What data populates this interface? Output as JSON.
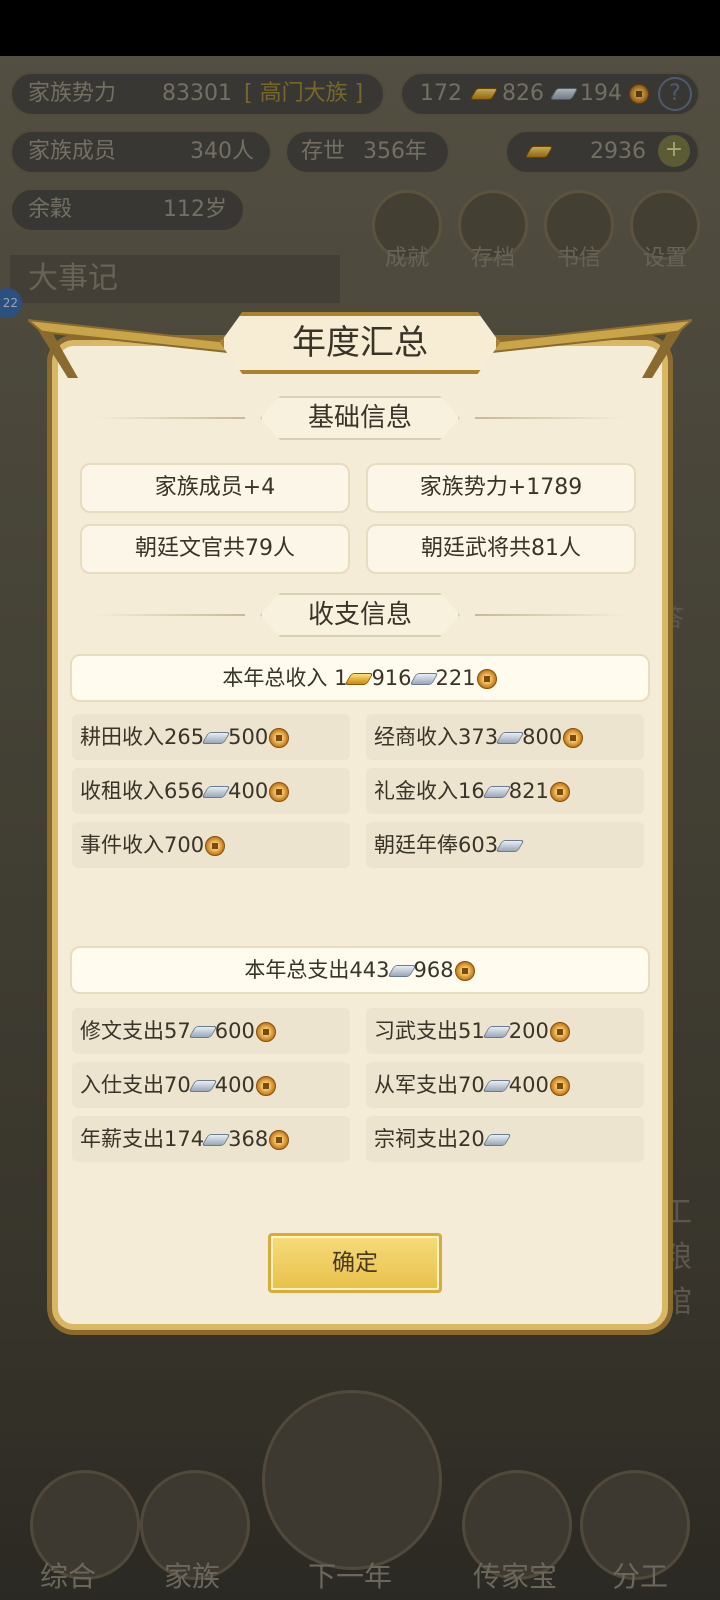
{
  "background": {
    "stats": {
      "power_label": "家族势力",
      "power_value": "83301",
      "power_rank": "[ 高门大族 ]",
      "resource_gold": "172",
      "resource_silver": "826",
      "resource_coin": "194",
      "members_label": "家族成员",
      "members_value": "340人",
      "exist_label": "存世",
      "exist_value": "356年",
      "ingot_value": "2936",
      "grain_label": "余穀",
      "grain_value": "112岁"
    },
    "round_buttons": [
      "成就",
      "存档",
      "书信",
      "设置"
    ],
    "chronicle_title": "大事记",
    "chronicle_badge": "22",
    "behind_text": [
      "答",
      "工",
      "粮",
      "馆"
    ],
    "nav": [
      "综合",
      "家族",
      "下一年",
      "传家宝",
      "分工"
    ]
  },
  "dialog": {
    "title": "年度汇总",
    "basic_section": "基础信息",
    "basic": [
      "家族成员+4",
      "家族势力+1789",
      "朝廷文官共79人",
      "朝廷武将共81人"
    ],
    "income_section": "收支信息",
    "income_total": {
      "label": "本年总收入",
      "gold": "1",
      "silver": "916",
      "coin": "221"
    },
    "income": [
      {
        "label": "耕田收入",
        "silver": "265",
        "coin": "500"
      },
      {
        "label": "经商收入",
        "silver": "373",
        "coin": "800"
      },
      {
        "label": "收租收入",
        "silver": "656",
        "coin": "400"
      },
      {
        "label": "礼金收入",
        "silver": "16",
        "coin": "821"
      },
      {
        "label": "事件收入",
        "silver": "",
        "coin": "700"
      },
      {
        "label": "朝廷年俸",
        "silver": "603",
        "coin": ""
      }
    ],
    "expense_total": {
      "label": "本年总支出",
      "silver": "443",
      "coin": "968"
    },
    "expense": [
      {
        "label": "修文支出",
        "silver": "57",
        "coin": "600"
      },
      {
        "label": "习武支出",
        "silver": "51",
        "coin": "200"
      },
      {
        "label": "入仕支出",
        "silver": "70",
        "coin": "400"
      },
      {
        "label": "从军支出",
        "silver": "70",
        "coin": "400"
      },
      {
        "label": "年薪支出",
        "silver": "174",
        "coin": "368"
      },
      {
        "label": "宗祠支出",
        "silver": "20",
        "coin": ""
      }
    ],
    "confirm": "确定"
  }
}
